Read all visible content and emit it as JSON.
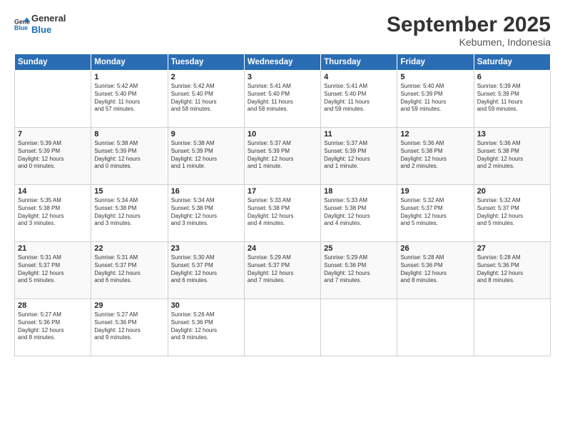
{
  "logo": {
    "line1": "General",
    "line2": "Blue"
  },
  "title": "September 2025",
  "location": "Kebumen, Indonesia",
  "days_header": [
    "Sunday",
    "Monday",
    "Tuesday",
    "Wednesday",
    "Thursday",
    "Friday",
    "Saturday"
  ],
  "weeks": [
    [
      {
        "day": "",
        "info": ""
      },
      {
        "day": "1",
        "info": "Sunrise: 5:42 AM\nSunset: 5:40 PM\nDaylight: 11 hours\nand 57 minutes."
      },
      {
        "day": "2",
        "info": "Sunrise: 5:42 AM\nSunset: 5:40 PM\nDaylight: 11 hours\nand 58 minutes."
      },
      {
        "day": "3",
        "info": "Sunrise: 5:41 AM\nSunset: 5:40 PM\nDaylight: 11 hours\nand 58 minutes."
      },
      {
        "day": "4",
        "info": "Sunrise: 5:41 AM\nSunset: 5:40 PM\nDaylight: 11 hours\nand 59 minutes."
      },
      {
        "day": "5",
        "info": "Sunrise: 5:40 AM\nSunset: 5:39 PM\nDaylight: 11 hours\nand 59 minutes."
      },
      {
        "day": "6",
        "info": "Sunrise: 5:39 AM\nSunset: 5:39 PM\nDaylight: 11 hours\nand 59 minutes."
      }
    ],
    [
      {
        "day": "7",
        "info": "Sunrise: 5:39 AM\nSunset: 5:39 PM\nDaylight: 12 hours\nand 0 minutes."
      },
      {
        "day": "8",
        "info": "Sunrise: 5:38 AM\nSunset: 5:39 PM\nDaylight: 12 hours\nand 0 minutes."
      },
      {
        "day": "9",
        "info": "Sunrise: 5:38 AM\nSunset: 5:39 PM\nDaylight: 12 hours\nand 1 minute."
      },
      {
        "day": "10",
        "info": "Sunrise: 5:37 AM\nSunset: 5:39 PM\nDaylight: 12 hours\nand 1 minute."
      },
      {
        "day": "11",
        "info": "Sunrise: 5:37 AM\nSunset: 5:39 PM\nDaylight: 12 hours\nand 1 minute."
      },
      {
        "day": "12",
        "info": "Sunrise: 5:36 AM\nSunset: 5:38 PM\nDaylight: 12 hours\nand 2 minutes."
      },
      {
        "day": "13",
        "info": "Sunrise: 5:36 AM\nSunset: 5:38 PM\nDaylight: 12 hours\nand 2 minutes."
      }
    ],
    [
      {
        "day": "14",
        "info": "Sunrise: 5:35 AM\nSunset: 5:38 PM\nDaylight: 12 hours\nand 3 minutes."
      },
      {
        "day": "15",
        "info": "Sunrise: 5:34 AM\nSunset: 5:38 PM\nDaylight: 12 hours\nand 3 minutes."
      },
      {
        "day": "16",
        "info": "Sunrise: 5:34 AM\nSunset: 5:38 PM\nDaylight: 12 hours\nand 3 minutes."
      },
      {
        "day": "17",
        "info": "Sunrise: 5:33 AM\nSunset: 5:38 PM\nDaylight: 12 hours\nand 4 minutes."
      },
      {
        "day": "18",
        "info": "Sunrise: 5:33 AM\nSunset: 5:38 PM\nDaylight: 12 hours\nand 4 minutes."
      },
      {
        "day": "19",
        "info": "Sunrise: 5:32 AM\nSunset: 5:37 PM\nDaylight: 12 hours\nand 5 minutes."
      },
      {
        "day": "20",
        "info": "Sunrise: 5:32 AM\nSunset: 5:37 PM\nDaylight: 12 hours\nand 5 minutes."
      }
    ],
    [
      {
        "day": "21",
        "info": "Sunrise: 5:31 AM\nSunset: 5:37 PM\nDaylight: 12 hours\nand 5 minutes."
      },
      {
        "day": "22",
        "info": "Sunrise: 5:31 AM\nSunset: 5:37 PM\nDaylight: 12 hours\nand 6 minutes."
      },
      {
        "day": "23",
        "info": "Sunrise: 5:30 AM\nSunset: 5:37 PM\nDaylight: 12 hours\nand 6 minutes."
      },
      {
        "day": "24",
        "info": "Sunrise: 5:29 AM\nSunset: 5:37 PM\nDaylight: 12 hours\nand 7 minutes."
      },
      {
        "day": "25",
        "info": "Sunrise: 5:29 AM\nSunset: 5:36 PM\nDaylight: 12 hours\nand 7 minutes."
      },
      {
        "day": "26",
        "info": "Sunrise: 5:28 AM\nSunset: 5:36 PM\nDaylight: 12 hours\nand 8 minutes."
      },
      {
        "day": "27",
        "info": "Sunrise: 5:28 AM\nSunset: 5:36 PM\nDaylight: 12 hours\nand 8 minutes."
      }
    ],
    [
      {
        "day": "28",
        "info": "Sunrise: 5:27 AM\nSunset: 5:36 PM\nDaylight: 12 hours\nand 8 minutes."
      },
      {
        "day": "29",
        "info": "Sunrise: 5:27 AM\nSunset: 5:36 PM\nDaylight: 12 hours\nand 9 minutes."
      },
      {
        "day": "30",
        "info": "Sunrise: 5:26 AM\nSunset: 5:36 PM\nDaylight: 12 hours\nand 9 minutes."
      },
      {
        "day": "",
        "info": ""
      },
      {
        "day": "",
        "info": ""
      },
      {
        "day": "",
        "info": ""
      },
      {
        "day": "",
        "info": ""
      }
    ]
  ]
}
